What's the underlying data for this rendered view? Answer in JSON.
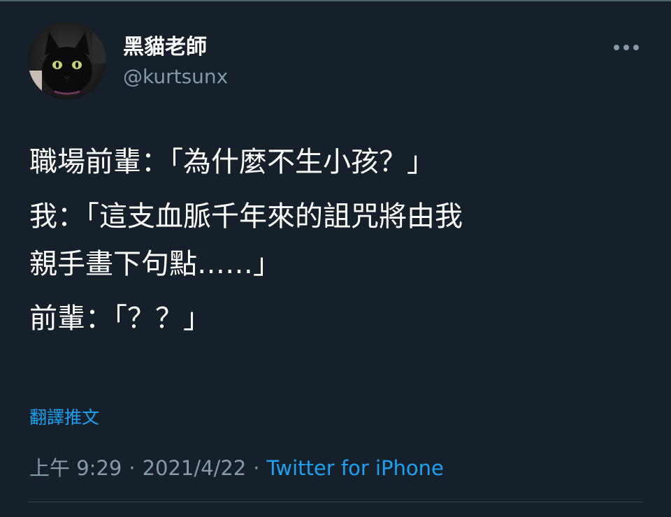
{
  "author": {
    "display_name": "黑貓老師",
    "handle": "@kurtsunx"
  },
  "tweet": {
    "paragraphs": [
      {
        "line1": "職場前輩：「為什麼不生小孩？」"
      },
      {
        "line1": "我：「這支血脈千年來的詛咒將由我",
        "line2": "親手畫下句點……」"
      },
      {
        "line1": "前輩：「？？」"
      }
    ],
    "translate_label": "翻譯推文",
    "time": "上午 9:29",
    "date": "2021/4/22",
    "source": "Twitter for iPhone",
    "separator": "·"
  },
  "icons": {
    "more": "more-horizontal-icon",
    "avatar": "black-cat-avatar"
  },
  "colors": {
    "background": "#15202b",
    "primary_text": "#ffffff",
    "secondary_text": "#8899a6",
    "link": "#1da1f2",
    "divider": "#38444d"
  }
}
